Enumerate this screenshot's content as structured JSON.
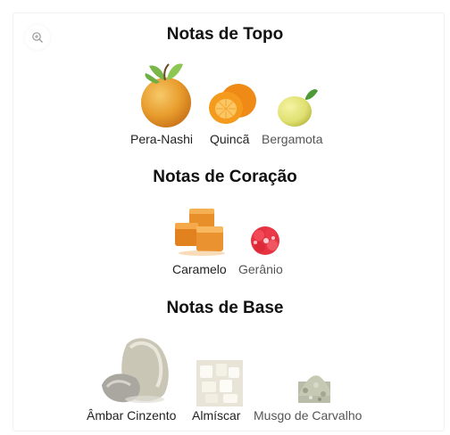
{
  "sections": {
    "top": {
      "title": "Notas de Topo",
      "items": [
        "Pera-Nashi",
        "Quincã",
        "Bergamota"
      ]
    },
    "heart": {
      "title": "Notas de Coração",
      "items": [
        "Caramelo",
        "Gerânio"
      ]
    },
    "base": {
      "title": "Notas de Base",
      "items": [
        "Âmbar Cinzento",
        "Almíscar",
        "Musgo de Carvalho"
      ]
    }
  },
  "icons": {
    "zoom": "zoom-in-icon"
  },
  "colors": {
    "heading": "#111111",
    "label_dark": "#222222",
    "label_gray": "#555555"
  }
}
